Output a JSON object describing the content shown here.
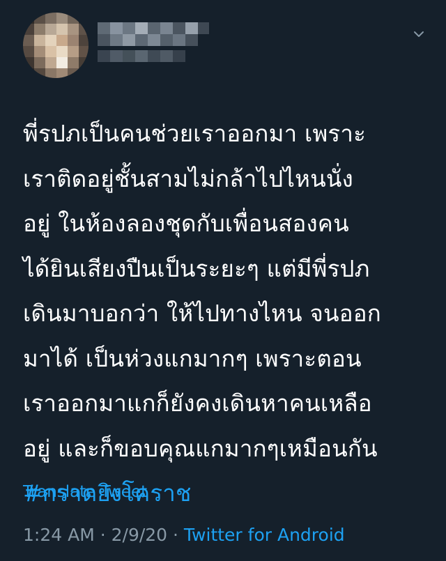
{
  "tweet": {
    "lines": [
      "พี่รปภเป็นคนช่วยเราออกมา เพราะ",
      "เราติดอยู่ชั้นสามไม่กล้าไปไหนนั่ง",
      "อยู่ ในห้องลองชุดกับเพื่อนสองคน",
      "ได้ยินเสียงปืนเป็นระยะๆ แต่มีพี่รปภ",
      "เดินมาบอกว่า ให้ไปทางไหน จนออก",
      "มาได้ เป็นห่วงแกมากๆ เพราะตอน",
      "เราออกมาแกก็ยังคงเดินหาคนเหลือ",
      "อยู่ และก็ขอบคุณแกมากๆเหมือนกัน"
    ],
    "hashtag": "#กราดยิงโคราช",
    "translate_label": "Translate Tweet",
    "time": "1:24 AM",
    "separator": " · ",
    "date": "2/9/20",
    "source": "Twitter for Android"
  },
  "colors": {
    "background": "#15202b",
    "link": "#1da1f2",
    "muted": "#8899a6"
  },
  "icons": {
    "menu": "chevron-down-icon",
    "avatar": "avatar-pixelated"
  }
}
